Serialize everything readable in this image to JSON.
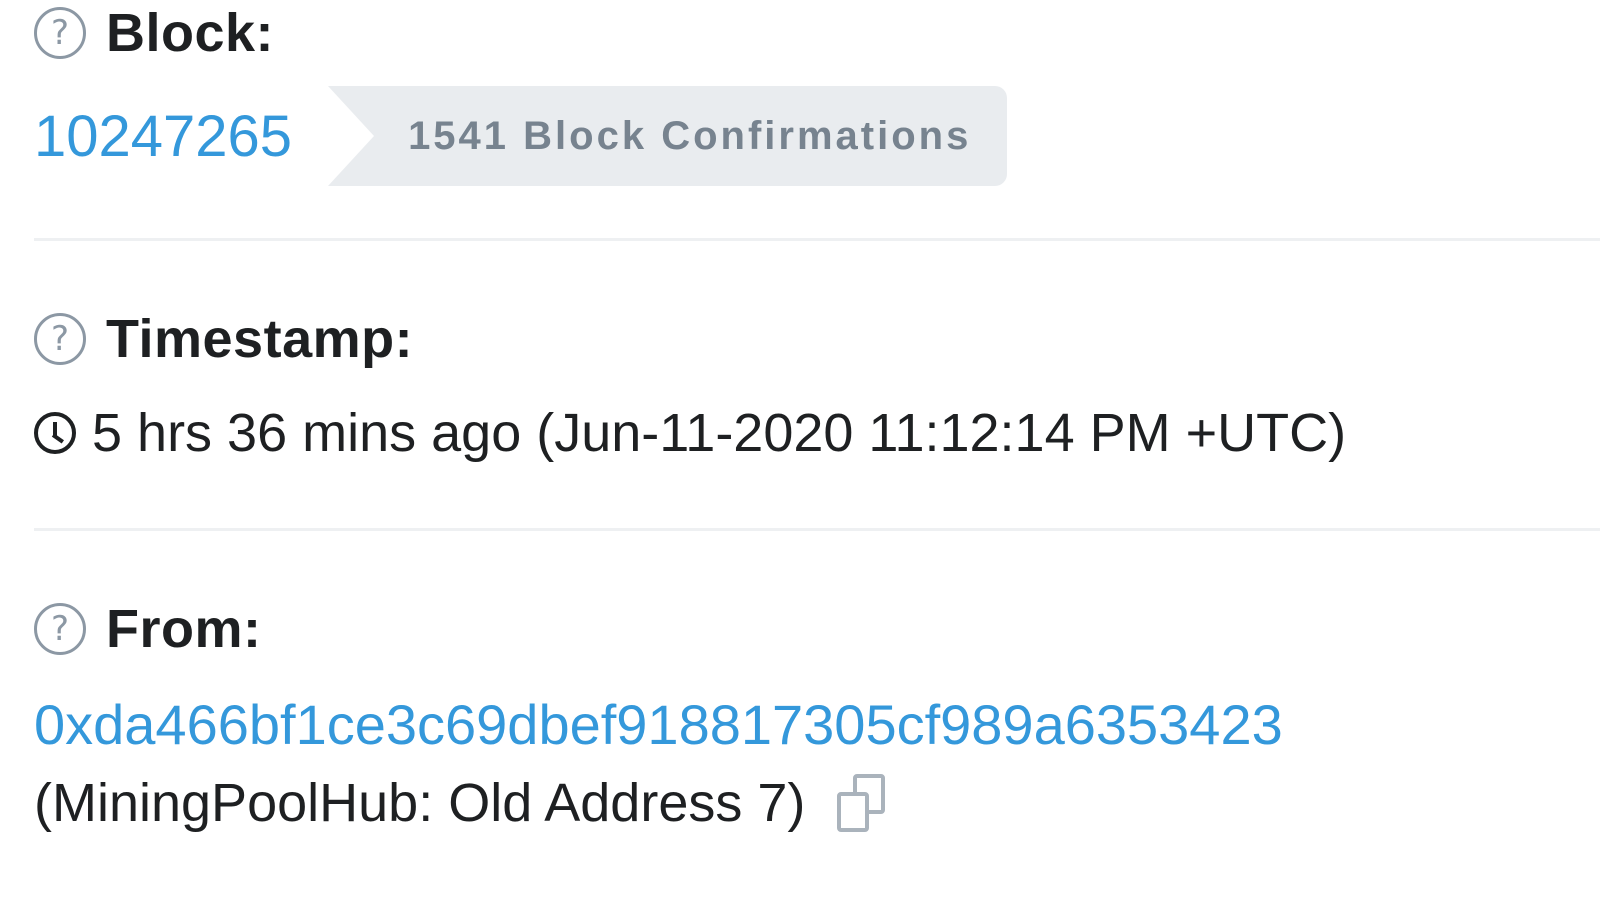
{
  "fields": {
    "block": {
      "label": "Block:",
      "number": "10247265",
      "confirmations": "1541 Block Confirmations"
    },
    "timestamp": {
      "label": "Timestamp:",
      "value": "5 hrs 36 mins ago (Jun-11-2020 11:12:14 PM +UTC)"
    },
    "from": {
      "label": "From:",
      "address": "0xda466bf1ce3c69dbef918817305cf989a6353423",
      "name_tag": "(MiningPoolHub: Old Address 7)"
    }
  },
  "icons": {
    "help": "question-circle-icon",
    "clock": "clock-icon",
    "copy": "copy-icon"
  },
  "colors": {
    "link": "#3498db",
    "badge_bg": "#e9ecef",
    "badge_text": "#77838f",
    "muted_icon": "#8c98a4"
  }
}
